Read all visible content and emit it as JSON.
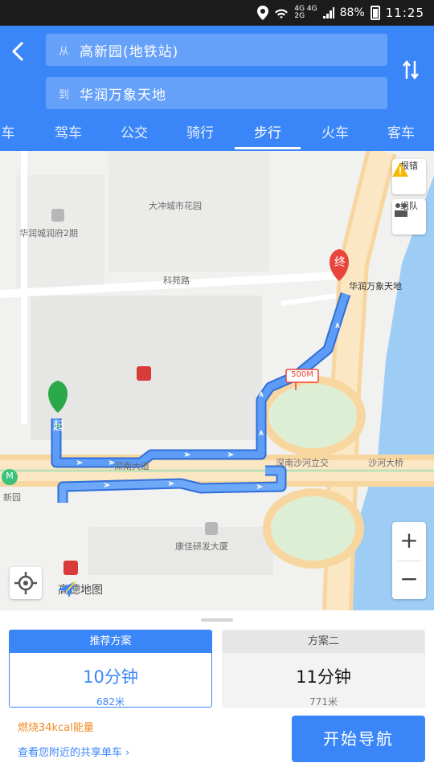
{
  "status_bar": {
    "network_top": "4G 4G",
    "network_bottom": "2G",
    "battery": "88%",
    "time": "11:25"
  },
  "route": {
    "from_prefix": "从",
    "from": "高新园(地铁站)",
    "to_prefix": "到",
    "to": "华润万象天地"
  },
  "tabs": [
    "车",
    "驾车",
    "公交",
    "骑行",
    "步行",
    "火车",
    "客车"
  ],
  "active_tab": "步行",
  "map": {
    "labels": {
      "garden": "大冲城市花园",
      "residence": "华润城润府2期",
      "road1": "科苑路",
      "destination": "华润万象天地",
      "road2": "深南大道",
      "road3": "深南沙河立交",
      "road4": "沙河大桥",
      "station_left": "新园",
      "building": "康佳研发大厦"
    },
    "start_marker": "起",
    "end_marker": "终",
    "distance_sign": "500M",
    "report_label": "报错",
    "team_label": "组队",
    "zoom_in": "+",
    "zoom_out": "−",
    "logo": "高德地图",
    "subway_icon": "M"
  },
  "plans": [
    {
      "header": "推荐方案",
      "duration": "10分钟",
      "distance": "682米"
    },
    {
      "header": "方案二",
      "duration": "11分钟",
      "distance": "771米"
    }
  ],
  "calorie_text": "燃烧34kcal能量",
  "bike_text": "查看您附近的共享单车 ›",
  "start_button": "开始导航",
  "colors": {
    "primary": "#3a86f8",
    "start_green": "#2aa84a",
    "end_red": "#e8453c",
    "calorie_orange": "#f08a24"
  }
}
